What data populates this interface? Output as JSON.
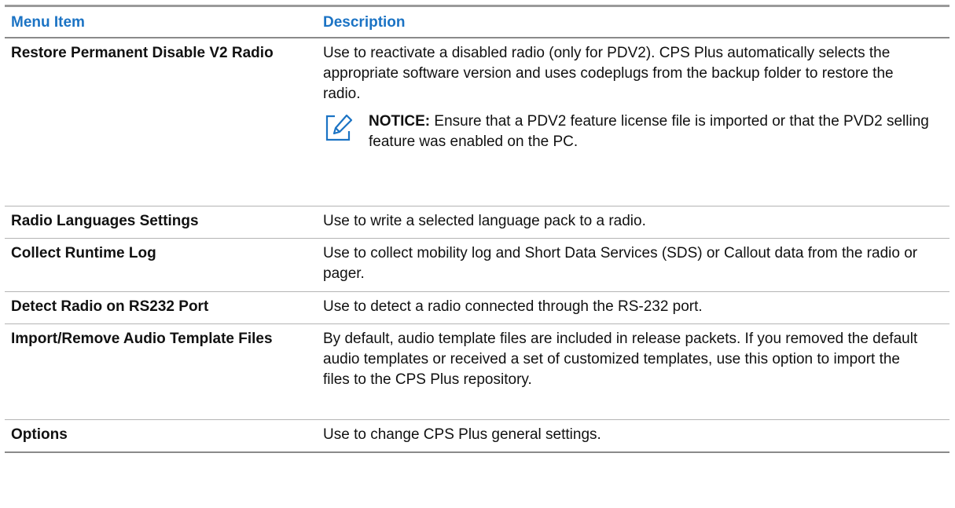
{
  "table": {
    "headers": {
      "menu_item": "Menu Item",
      "description": "Description"
    },
    "rows": [
      {
        "item": "Restore Permanent Disable V2 Radio",
        "description": "Use to reactivate a disabled radio (only for PDV2). CPS Plus automatically selects the appropriate software version and uses codeplugs from the backup folder to restore the radio.",
        "notice_label": "NOTICE:",
        "notice_text": "Ensure that a PDV2 feature license file is imported or that the PVD2 selling feature was enabled on the PC."
      },
      {
        "item": "Radio Languages Settings",
        "description": "Use to write a selected language pack to a radio."
      },
      {
        "item": "Collect Runtime Log",
        "description": "Use to collect mobility log and Short Data Services (SDS) or Callout data from the radio or pager."
      },
      {
        "item": "Detect Radio on RS232 Port",
        "description": "Use to detect a radio connected through the RS-232 port."
      },
      {
        "item": "Import/Remove Audio Template Files",
        "description": "By default, audio template files are included in release packets. If you removed the default audio templates or received a set of customized templates, use this option to import the files to the CPS Plus repository."
      },
      {
        "item": "Options",
        "description": "Use to change CPS Plus general settings."
      }
    ]
  },
  "colors": {
    "header_text": "#1b73c4",
    "notice_icon": "#1b73c4"
  },
  "icons": {
    "notice": "pencil-note-icon"
  }
}
